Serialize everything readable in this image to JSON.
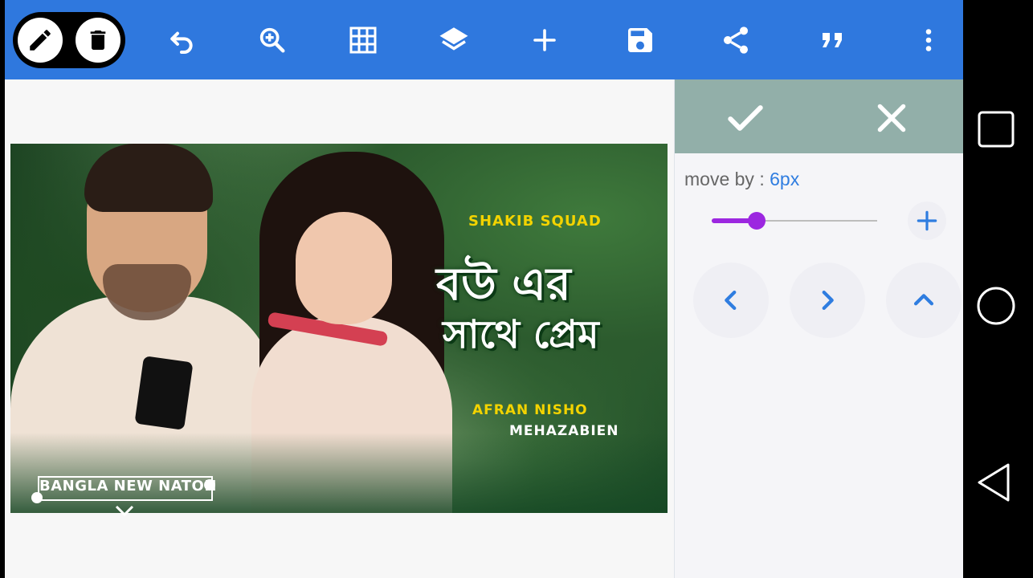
{
  "toolbar": {
    "icons": [
      "pencil-icon",
      "trash-icon",
      "undo-icon",
      "zoom-in-icon",
      "grid-icon",
      "layers-icon",
      "add-icon",
      "save-icon",
      "share-icon",
      "quote-icon",
      "more-vert-icon"
    ],
    "colors": {
      "bar": "#2f78de",
      "icon": "#ffffff"
    }
  },
  "canvas": {
    "texts": {
      "shakib_squad": "SHAKIB SQUAD",
      "title_line1": "বউ এর",
      "title_line2": "সাথে প্রেম",
      "afran_nisho": "AFRAN NISHO",
      "mehazabien": "MEHAZABIEN",
      "bangla_new_nation": "BANGLA NEW NATON"
    }
  },
  "panel": {
    "confirm_icon": "check-icon",
    "cancel_icon": "close-icon",
    "move_label": "move by : ",
    "move_value": "6px",
    "slider_level_fraction": 0.27,
    "arrow_icons": [
      "chevron-left-icon",
      "chevron-right-icon",
      "chevron-up-icon"
    ],
    "colors": {
      "accent": "#2f7de0",
      "slider": "#9c27e0",
      "header": "#92afa9"
    }
  },
  "system_nav": [
    "recents-square-icon",
    "home-circle-icon",
    "back-triangle-icon"
  ]
}
